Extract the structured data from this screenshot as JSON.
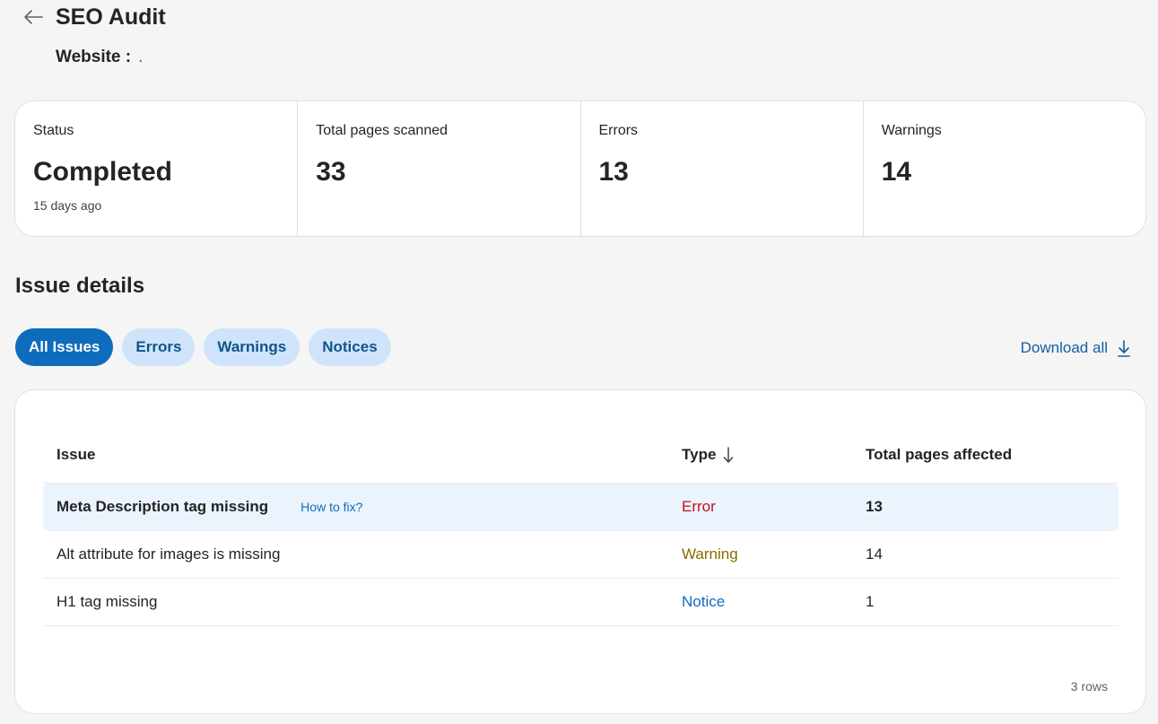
{
  "header": {
    "title": "SEO Audit",
    "website_label": "Website :",
    "website_value": "."
  },
  "stats": [
    {
      "label": "Status",
      "value": "Completed",
      "sub": "15 days ago"
    },
    {
      "label": "Total pages scanned",
      "value": "33"
    },
    {
      "label": "Errors",
      "value": "13"
    },
    {
      "label": "Warnings",
      "value": "14"
    }
  ],
  "issues": {
    "title": "Issue details",
    "filters": [
      "All Issues",
      "Errors",
      "Warnings",
      "Notices"
    ],
    "active_filter": "All Issues",
    "download_label": "Download all",
    "columns": {
      "issue": "Issue",
      "type": "Type",
      "total": "Total pages affected"
    },
    "rows": [
      {
        "issue": "Meta Description tag missing",
        "howto": "How to fix?",
        "type": "Error",
        "total": "13"
      },
      {
        "issue": "Alt attribute for images is missing",
        "type": "Warning",
        "total": "14"
      },
      {
        "issue": "H1 tag missing",
        "type": "Notice",
        "total": "1"
      }
    ],
    "row_count": "3 rows"
  },
  "icons": {
    "back": "arrow-left-icon",
    "sort": "arrow-down-icon",
    "download": "download-icon"
  },
  "colors": {
    "accent": "#0f6cbd",
    "error": "#c50f1f",
    "warning": "#8a6a00",
    "notice": "#0f6cbd"
  }
}
